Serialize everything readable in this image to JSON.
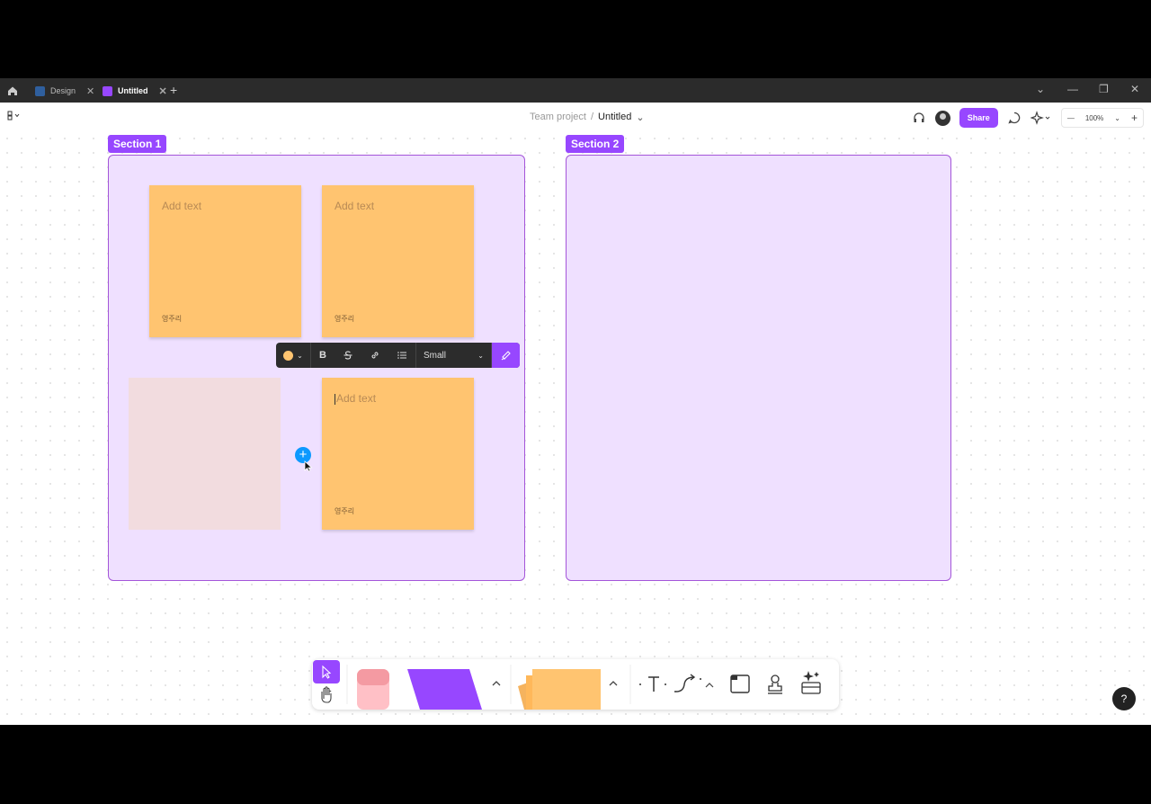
{
  "tabs": [
    {
      "label": "Design",
      "color": "#2f5f9e"
    },
    {
      "label": "Untitled",
      "color": "#9747ff"
    }
  ],
  "window_controls": {
    "dropdown": "⌄",
    "minimize": "—",
    "restore": "❐",
    "close": "✕"
  },
  "topbar": {
    "project": "Team project",
    "separator": "/",
    "file_name": "Untitled",
    "share_label": "Share",
    "zoom_label": "100%"
  },
  "sections": [
    {
      "label": "Section 1"
    },
    {
      "label": "Section 2"
    }
  ],
  "stickies": [
    {
      "placeholder": "Add text",
      "author": "영주리",
      "color": "#ffc470"
    },
    {
      "placeholder": "Add text",
      "author": "영주리",
      "color": "#ffc470"
    },
    {
      "placeholder": "Add text",
      "author": "영주리",
      "color": "#ffc470"
    }
  ],
  "format_toolbar": {
    "color": "#ffc470",
    "bold": "B",
    "size_label": "Small"
  },
  "help_label": "?",
  "colors": {
    "accent": "#9747ff",
    "section_fill": "#efe0ff",
    "sticky": "#ffc470",
    "ghost_sticky": "#f2dcdf",
    "add_button": "#0d99ff"
  }
}
